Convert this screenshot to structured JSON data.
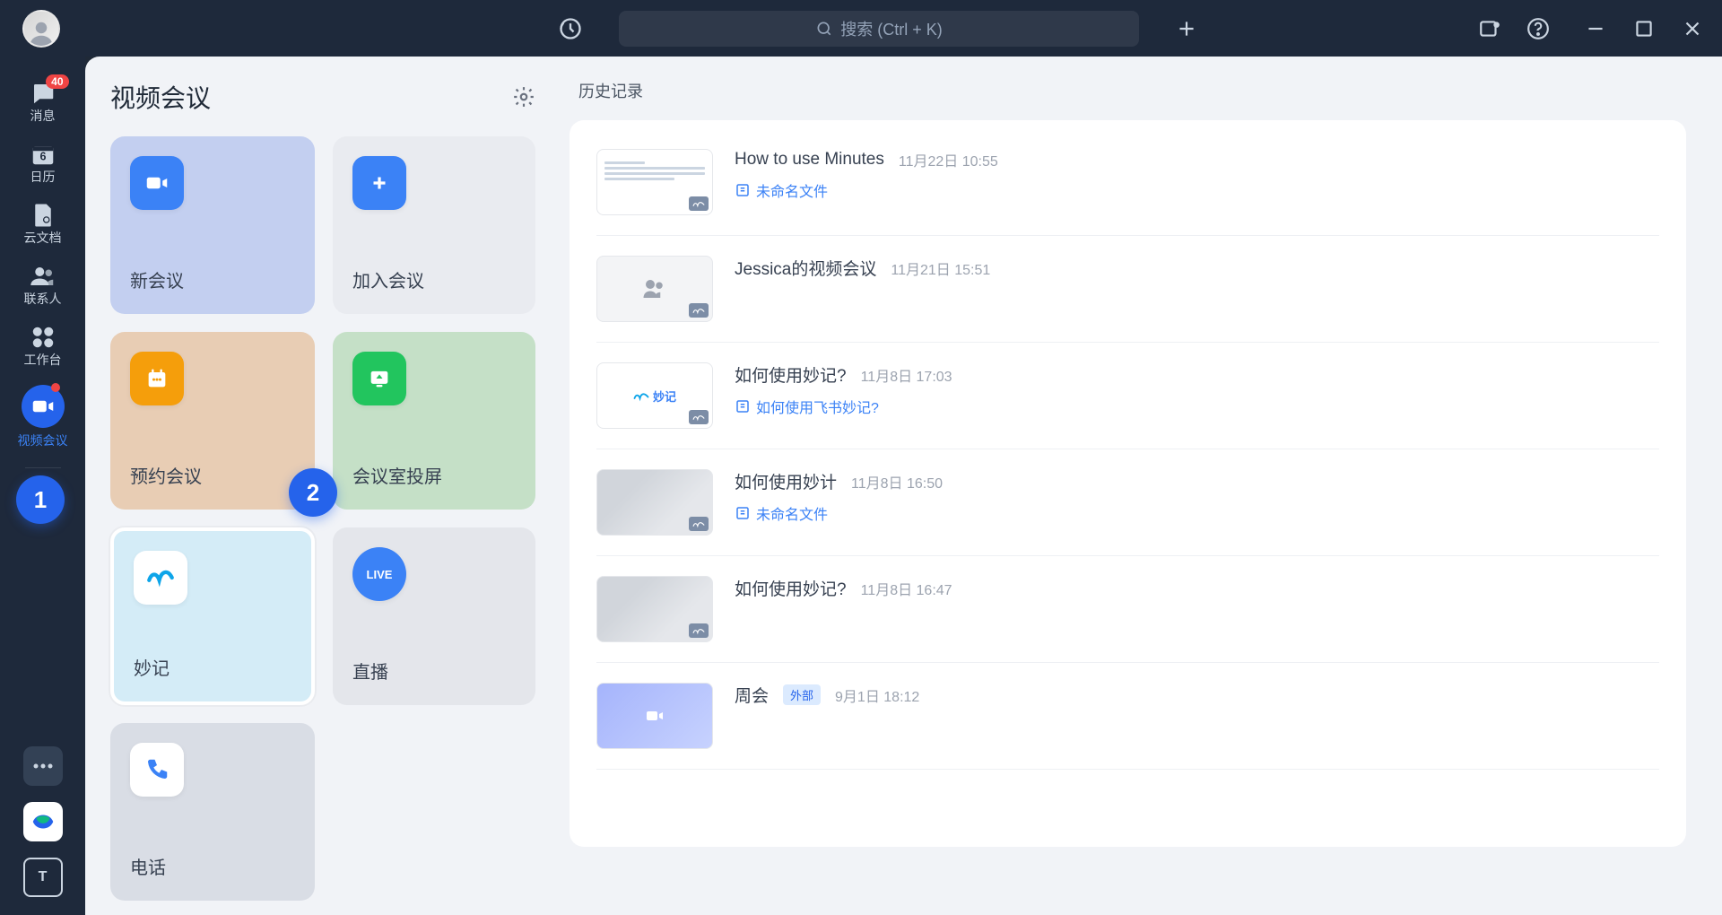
{
  "search": {
    "placeholder": "搜索 (Ctrl + K)"
  },
  "sidebar": {
    "items": [
      {
        "label": "消息",
        "badge": "40"
      },
      {
        "label": "日历"
      },
      {
        "label": "云文档"
      },
      {
        "label": "联系人"
      },
      {
        "label": "工作台"
      },
      {
        "label": "视频会议"
      },
      {
        "label": "更多"
      }
    ],
    "bottom_letter": "T"
  },
  "panel": {
    "title": "视频会议"
  },
  "tiles": {
    "new_meeting": "新会议",
    "join": "加入会议",
    "schedule": "预约会议",
    "cast": "会议室投屏",
    "minutes": "妙记",
    "live": "直播",
    "phone": "电话"
  },
  "live_chip": "LIVE",
  "history": {
    "title": "历史记录",
    "rows": [
      {
        "title": "How to use Minutes",
        "time": "11月22日 10:55",
        "attach": "未命名文件",
        "thumb": "doc"
      },
      {
        "title": "Jessica的视频会议",
        "time": "11月21日 15:51",
        "thumb": "people"
      },
      {
        "title": "如何使用妙记?",
        "time": "11月8日 17:03",
        "attach": "如何使用飞书妙记?",
        "thumb": "text",
        "thumb_text": "妙记"
      },
      {
        "title": "如何使用妙计",
        "time": "11月8日 16:50",
        "attach": "未命名文件",
        "thumb": "blur"
      },
      {
        "title": "如何使用妙记?",
        "time": "11月8日 16:47",
        "thumb": "blur"
      },
      {
        "title": "周会",
        "time": "9月1日 18:12",
        "tag": "外部",
        "thumb": "vid"
      }
    ]
  },
  "steps": {
    "s1": "1",
    "s2": "2"
  }
}
